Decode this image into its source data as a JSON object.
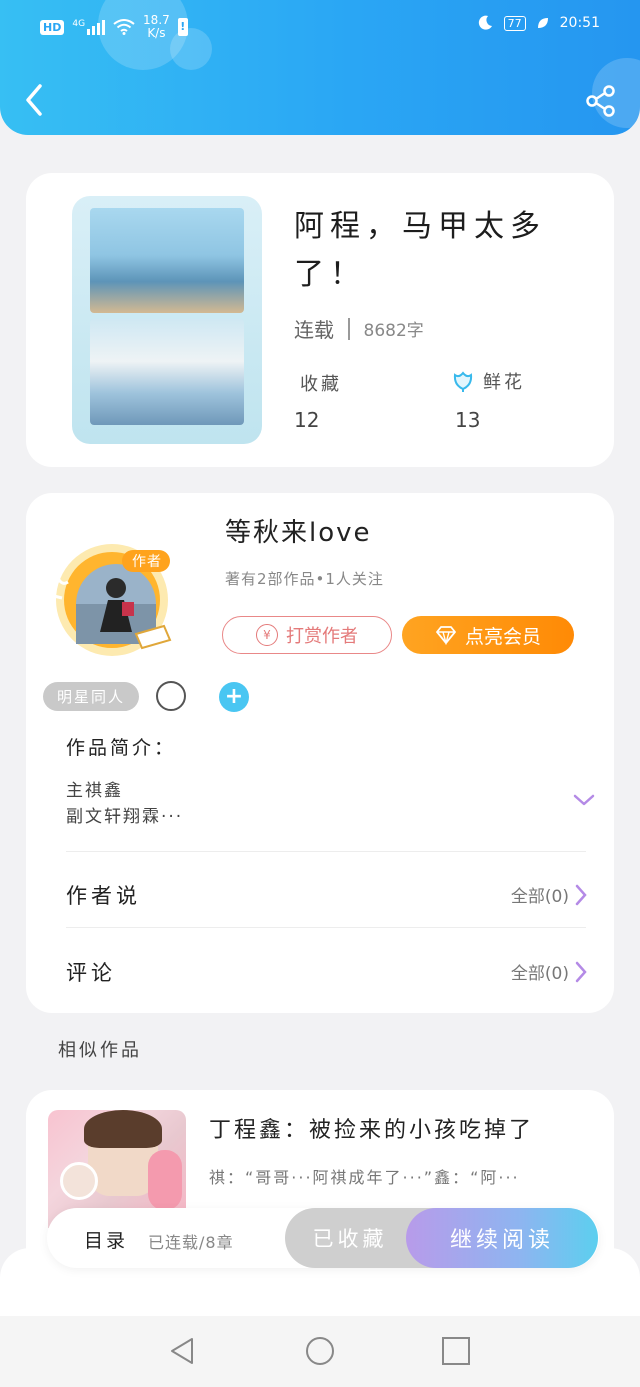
{
  "status_bar": {
    "hd": "HD",
    "network": "4G",
    "speed_value": "18.7",
    "speed_unit": "K/s",
    "battery": "77",
    "time": "20:51"
  },
  "book": {
    "title": "阿程，马甲太多了！",
    "status": "连载",
    "word_count": "8682字",
    "favorites_label": "收藏",
    "favorites_count": "12",
    "flowers_label": "鲜花",
    "flowers_count": "13"
  },
  "author": {
    "badge": "作者",
    "name": "等秋来love",
    "summary": "著有2部作品•1人关注",
    "tip_label": "打赏作者",
    "tip_icon": "¥",
    "vip_label": "点亮会员"
  },
  "tags": {
    "tag1": "明星同人",
    "add_symbol": "+"
  },
  "intro": {
    "label": "作品简介：",
    "line1": "主祺鑫",
    "line2": "副文轩翔霖···"
  },
  "author_says": {
    "label": "作者说",
    "more": "全部(0)"
  },
  "comments": {
    "label": "评论",
    "more": "全部(0)"
  },
  "similar": {
    "section_title": "相似作品",
    "items": [
      {
        "title": "丁程鑫：被捡来的小孩吃掉了",
        "desc": "祺：“哥哥···阿祺成年了···”鑫：“阿···"
      }
    ]
  },
  "bottom": {
    "toc_label": "目录",
    "toc_status": "已连载/8章",
    "collected_label": "已收藏",
    "read_label": "继续阅读"
  },
  "icons": [
    "back-arrow-icon",
    "share-icon",
    "flower-icon",
    "diamond-icon",
    "chevron-down-icon",
    "chevron-right-icon",
    "nav-back-icon",
    "nav-home-icon",
    "nav-recents-icon"
  ]
}
